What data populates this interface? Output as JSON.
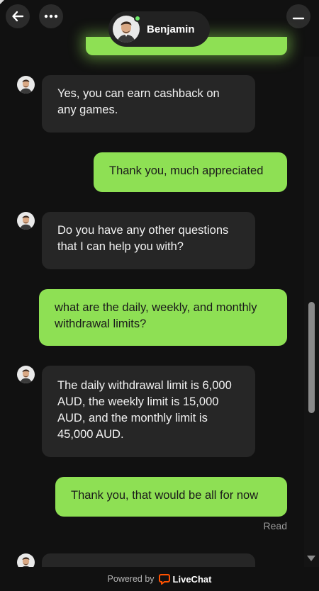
{
  "header": {
    "agent_name": "Benjamin"
  },
  "messages": [
    {
      "from": "agent",
      "text": "Yes, you can earn cashback on any games."
    },
    {
      "from": "user",
      "text": "Thank you, much appreciated"
    },
    {
      "from": "agent",
      "text": "Do you have any other questions that I can help you with?"
    },
    {
      "from": "user",
      "text": "what are the daily, weekly, and monthly withdrawal limits?"
    },
    {
      "from": "agent",
      "text": "The daily withdrawal limit is 6,000 AUD, the weekly limit is 15,000 AUD, and the monthly limit is 45,000 AUD."
    },
    {
      "from": "user",
      "text": "Thank you, that would be all for now"
    }
  ],
  "read_status": "Read",
  "footer": {
    "powered_by": "Powered by",
    "brand": "LiveChat"
  },
  "colors": {
    "user_bubble": "#8ee054",
    "agent_bubble": "#262626",
    "background": "#111111",
    "online": "#6ee86a",
    "brand_icon": "#ff5100"
  }
}
